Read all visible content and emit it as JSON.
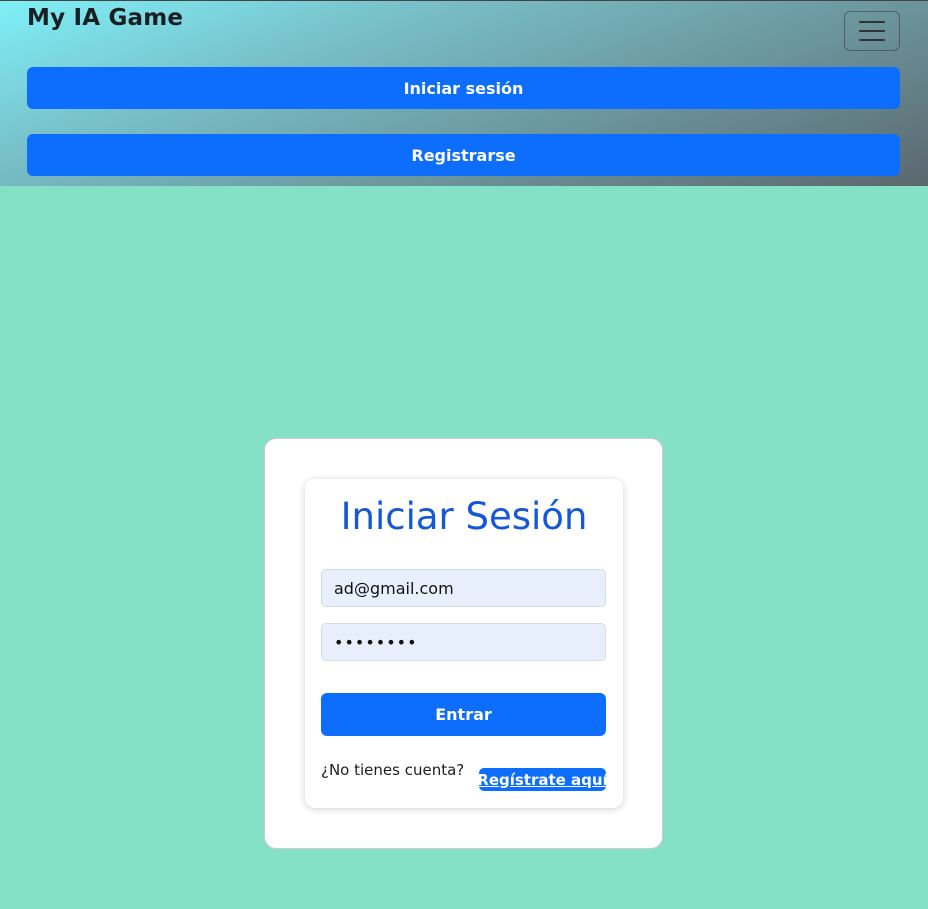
{
  "navbar": {
    "brand": "My IA Game",
    "toggler_icon": "hamburger-menu-icon",
    "login_label": "Iniciar sesión",
    "register_label": "Registrarse"
  },
  "login_form": {
    "title": "Iniciar Sesión",
    "email_value": "ad@gmail.com",
    "password_value": "••••••••",
    "submit_label": "Entrar",
    "no_account_text": "¿No tienes cuenta?",
    "register_link_label": "Regístrate aquí"
  },
  "colors": {
    "page_background": "#84e1c5",
    "primary": "#0d6efd",
    "title": "#1558d6",
    "input_background": "#e8f0fe"
  }
}
